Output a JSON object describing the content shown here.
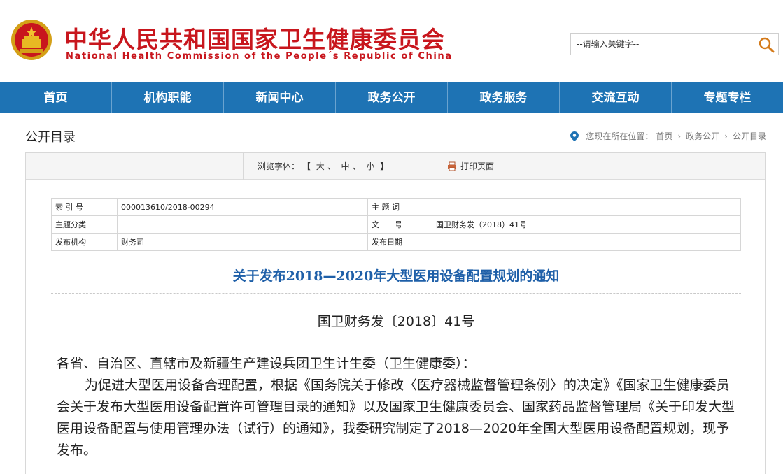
{
  "header": {
    "title_cn": "中华人民共和国国家卫生健康委员会",
    "title_en": "National Health Commission of the People´s Republic of China",
    "search_placeholder": "--请输入关键字--",
    "brand_red": "#c8161d"
  },
  "nav": {
    "bg_color": "#1e73b4",
    "items": [
      {
        "label": "首页"
      },
      {
        "label": "机构职能"
      },
      {
        "label": "新闻中心"
      },
      {
        "label": "政务公开"
      },
      {
        "label": "政务服务"
      },
      {
        "label": "交流互动"
      },
      {
        "label": "专题专栏"
      }
    ]
  },
  "page": {
    "section_title": "公开目录",
    "breadcrumb_prefix": "您现在所在位置：",
    "breadcrumb": [
      "首页",
      "政务公开",
      "公开目录"
    ]
  },
  "toolbar": {
    "font_label": "浏览字体：",
    "bracket_open": "【",
    "bracket_close": "】",
    "sizes": [
      "大",
      "中",
      "小"
    ],
    "print_label": "打印页面"
  },
  "meta": {
    "rows": [
      {
        "k1": "索 引 号",
        "v1": "000013610/2018-00294",
        "k2": "主 题 词",
        "v2": ""
      },
      {
        "k1": "主题分类",
        "v1": "",
        "k2": "文　　号",
        "v2": "国卫财务发（2018）41号"
      },
      {
        "k1": "发布机构",
        "v1": "财务司",
        "k2": "发布日期",
        "v2": ""
      }
    ]
  },
  "doc": {
    "title": "关于发布2018—2020年大型医用设备配置规划的通知",
    "number": "国卫财务发〔2018〕41号",
    "salutation": "各省、自治区、直辖市及新疆生产建设兵团卫生计生委（卫生健康委）：",
    "paragraph": "为促进大型医用设备合理配置，根据《国务院关于修改〈医疗器械监督管理条例〉的决定》《国家卫生健康委员会关于发布大型医用设备配置许可管理目录的通知》以及国家卫生健康委员会、国家药品监督管理局《关于印发大型医用设备配置与使用管理办法（试行）的通知》，我委研究制定了2018—2020年全国大型医用设备配置规划，现予发布。",
    "title_color": "#1e5fa8"
  }
}
